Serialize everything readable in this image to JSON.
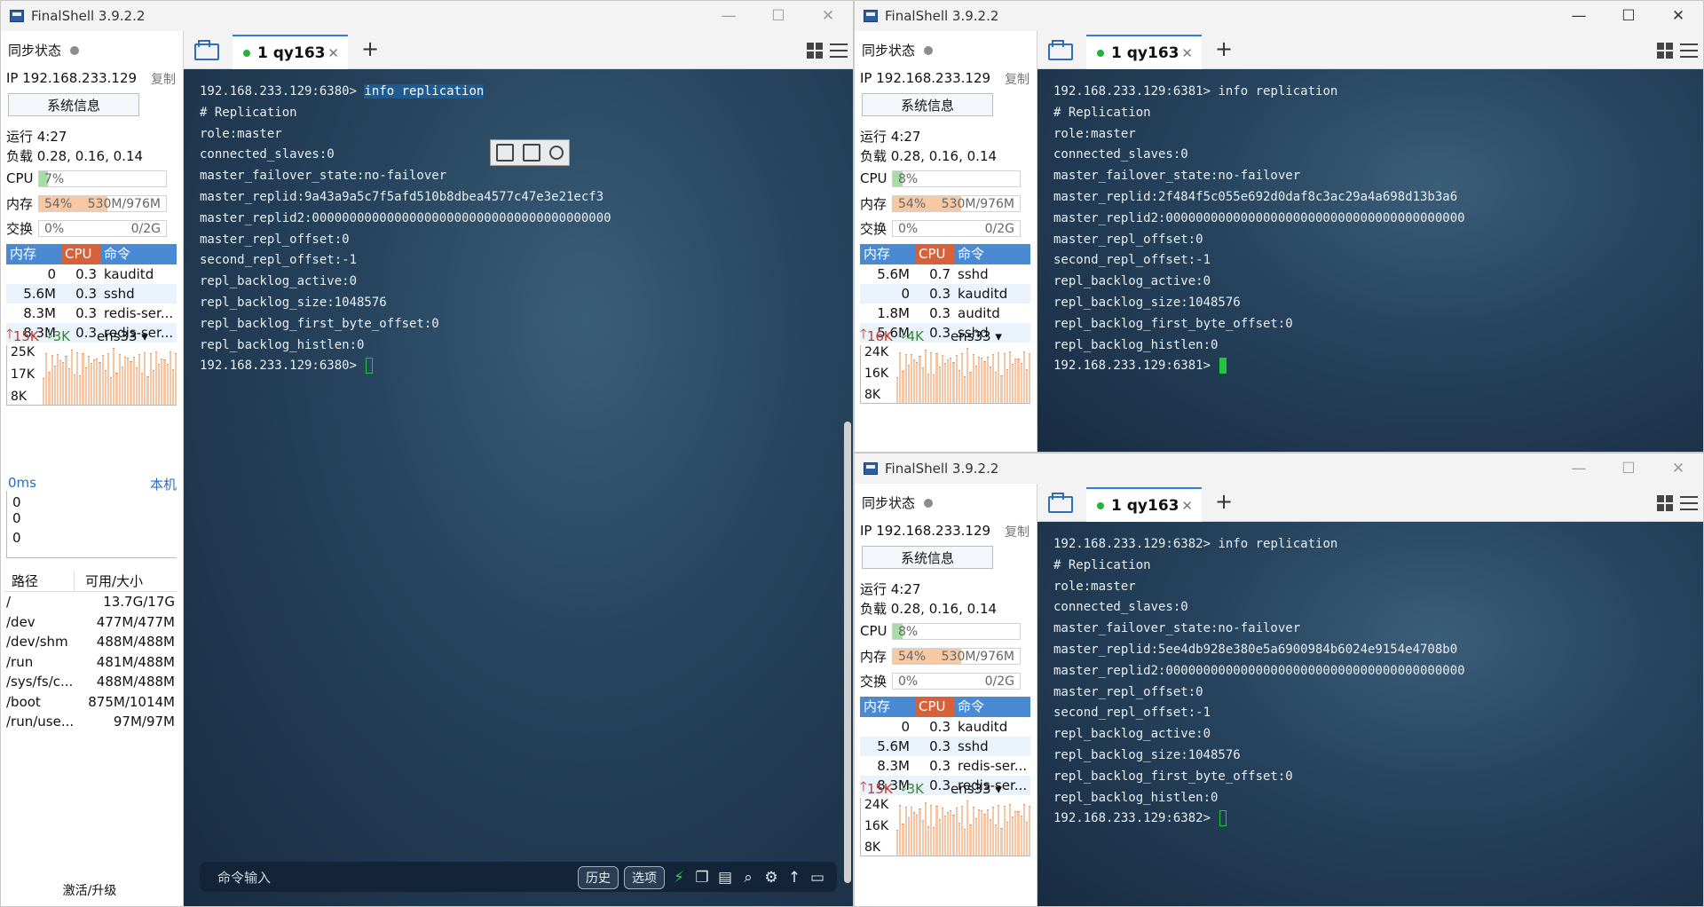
{
  "app_title": "FinalShell 3.9.2.2",
  "window_controls": {
    "minimize": "—",
    "maximize": "☐",
    "close": "✕"
  },
  "sidebar_labels": {
    "sync": "同步状态",
    "copy": "复制",
    "sysinfo": "系统信息",
    "cpu": "CPU",
    "mem": "内存",
    "swap": "交换",
    "proc_headers": [
      "内存",
      "CPU",
      "命令"
    ],
    "latency": "0ms",
    "local": "本机",
    "disk_headers": [
      "路径",
      "可用/大小"
    ],
    "activate": "激活/升级"
  },
  "tab": {
    "label": "1 qy163",
    "close": "✕",
    "plus": "+"
  },
  "colors": {
    "mem_header": "#4a8ad2",
    "cpu_header": "#d6613b",
    "cmd_header": "#4a8ad2",
    "cpu_fill": "#a7dca7",
    "mem_fill": "#f6c9a3",
    "accent_tab": "#2d7ee0"
  },
  "windows": [
    {
      "id": "main",
      "ip": "IP 192.168.233.129",
      "uptime": "运行 4:27",
      "load": "负载 0.28, 0.16, 0.14",
      "cpu_pct": "7%",
      "cpu_level": 7,
      "mem_pct": "54%",
      "mem_amt": "530M/976M",
      "mem_level": 54,
      "swap_pct": "0%",
      "swap_amt": "0/2G",
      "procs": [
        {
          "mem": "0",
          "cpu": "0.3",
          "cmd": "kauditd"
        },
        {
          "mem": "5.6M",
          "cpu": "0.3",
          "cmd": "sshd"
        },
        {
          "mem": "8.3M",
          "cpu": "0.3",
          "cmd": "redis-ser..."
        },
        {
          "mem": "8.3M",
          "cpu": "0.3",
          "cmd": "redis-ser..."
        }
      ],
      "net_up": "15K",
      "net_down": "3K",
      "iface": "ens33",
      "net_ticks": [
        "25K",
        "17K",
        "8K"
      ],
      "latency_values": [
        "0",
        "0",
        "0"
      ],
      "disks": [
        {
          "path": "/",
          "size": "13.7G/17G"
        },
        {
          "path": "/dev",
          "size": "477M/477M"
        },
        {
          "path": "/dev/shm",
          "size": "488M/488M"
        },
        {
          "path": "/run",
          "size": "481M/488M"
        },
        {
          "path": "/sys/fs/c...",
          "size": "488M/488M"
        },
        {
          "path": "/boot",
          "size": "875M/1014M"
        },
        {
          "path": "/run/use...",
          "size": "97M/97M"
        }
      ],
      "terminal_lines": [
        {
          "prompt": "192.168.233.129:6380> ",
          "cmd": "info replication"
        },
        {
          "text": "# Replication"
        },
        {
          "text": "role:master"
        },
        {
          "text": "connected_slaves:0"
        },
        {
          "text": "master_failover_state:no-failover"
        },
        {
          "text": "master_replid:9a43a9a5c7f5afd510b8dbea4577c47e3e21ecf3"
        },
        {
          "text": "master_replid2:0000000000000000000000000000000000000000"
        },
        {
          "text": "master_repl_offset:0"
        },
        {
          "text": "second_repl_offset:-1"
        },
        {
          "text": "repl_backlog_active:0"
        },
        {
          "text": "repl_backlog_size:1048576"
        },
        {
          "text": "repl_backlog_first_byte_offset:0"
        },
        {
          "text": "repl_backlog_histlen:0"
        },
        {
          "prompt": "192.168.233.129:6380> ",
          "cursor": "hollow"
        }
      ],
      "command_input": {
        "placeholder": "命令输入",
        "history": "历史",
        "options": "选项"
      }
    },
    {
      "id": "top-right",
      "ip": "IP 192.168.233.129",
      "uptime": "运行 4:27",
      "load": "负载 0.28, 0.16, 0.14",
      "cpu_pct": "8%",
      "cpu_level": 8,
      "mem_pct": "54%",
      "mem_amt": "530M/976M",
      "mem_level": 54,
      "swap_pct": "0%",
      "swap_amt": "0/2G",
      "procs": [
        {
          "mem": "5.6M",
          "cpu": "0.7",
          "cmd": "sshd"
        },
        {
          "mem": "0",
          "cpu": "0.3",
          "cmd": "kauditd"
        },
        {
          "mem": "1.8M",
          "cpu": "0.3",
          "cmd": "auditd"
        },
        {
          "mem": "5.6M",
          "cpu": "0.3",
          "cmd": "sshd"
        }
      ],
      "net_up": "16K",
      "net_down": "4K",
      "iface": "ens33",
      "net_ticks": [
        "24K",
        "16K",
        "8K"
      ],
      "terminal_lines": [
        {
          "prompt": "192.168.233.129:6381> ",
          "cmd_plain": "info replication"
        },
        {
          "text": "# Replication"
        },
        {
          "text": "role:master"
        },
        {
          "text": "connected_slaves:0"
        },
        {
          "text": "master_failover_state:no-failover"
        },
        {
          "text": "master_replid:2f484f5c055e692d0daf8c3ac29a4a698d13b3a6"
        },
        {
          "text": "master_replid2:0000000000000000000000000000000000000000"
        },
        {
          "text": "master_repl_offset:0"
        },
        {
          "text": "second_repl_offset:-1"
        },
        {
          "text": "repl_backlog_active:0"
        },
        {
          "text": "repl_backlog_size:1048576"
        },
        {
          "text": "repl_backlog_first_byte_offset:0"
        },
        {
          "text": "repl_backlog_histlen:0"
        },
        {
          "prompt": "192.168.233.129:6381> ",
          "cursor": "solid"
        }
      ]
    },
    {
      "id": "bottom-right",
      "ip": "IP 192.168.233.129",
      "uptime": "运行 4:27",
      "load": "负载 0.28, 0.16, 0.14",
      "cpu_pct": "8%",
      "cpu_level": 8,
      "mem_pct": "54%",
      "mem_amt": "530M/976M",
      "mem_level": 54,
      "swap_pct": "0%",
      "swap_amt": "0/2G",
      "procs": [
        {
          "mem": "0",
          "cpu": "0.3",
          "cmd": "kauditd"
        },
        {
          "mem": "5.6M",
          "cpu": "0.3",
          "cmd": "sshd"
        },
        {
          "mem": "8.3M",
          "cpu": "0.3",
          "cmd": "redis-ser..."
        },
        {
          "mem": "8.3M",
          "cpu": "0.3",
          "cmd": "redis-ser..."
        }
      ],
      "net_up": "15K",
      "net_down": "3K",
      "iface": "ens33",
      "net_ticks": [
        "24K",
        "16K",
        "8K"
      ],
      "terminal_lines": [
        {
          "prompt": "192.168.233.129:6382> ",
          "cmd_plain": "info replication"
        },
        {
          "text": "# Replication"
        },
        {
          "text": "role:master"
        },
        {
          "text": "connected_slaves:0"
        },
        {
          "text": "master_failover_state:no-failover"
        },
        {
          "text": "master_replid:5ee4db928e380e5a6900984b6024e9154e4708b0"
        },
        {
          "text": "master_replid2:0000000000000000000000000000000000000000"
        },
        {
          "text": "master_repl_offset:0"
        },
        {
          "text": "second_repl_offset:-1"
        },
        {
          "text": "repl_backlog_active:0"
        },
        {
          "text": "repl_backlog_size:1048576"
        },
        {
          "text": "repl_backlog_first_byte_offset:0"
        },
        {
          "text": "repl_backlog_histlen:0"
        },
        {
          "prompt": "192.168.233.129:6382> ",
          "cursor": "hollow"
        }
      ]
    }
  ]
}
